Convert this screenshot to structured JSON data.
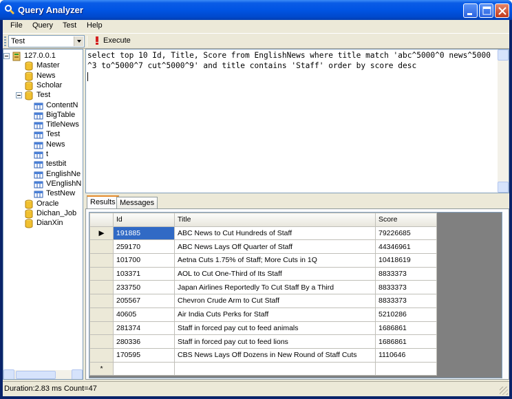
{
  "window": {
    "title": "Query Analyzer"
  },
  "menu": {
    "items": [
      "File",
      "Query",
      "Test",
      "Help"
    ]
  },
  "toolbar": {
    "database": "Test",
    "execute_label": "Execute"
  },
  "tree": {
    "nodes": [
      {
        "label": "127.0.0.1",
        "icon": "server-icon",
        "level": 0,
        "expander": true
      },
      {
        "label": "Master",
        "icon": "database-icon",
        "level": 1
      },
      {
        "label": "News",
        "icon": "database-icon",
        "level": 1
      },
      {
        "label": "Scholar",
        "icon": "database-icon",
        "level": 1
      },
      {
        "label": "Test",
        "icon": "database-icon",
        "level": 1,
        "expander": true
      },
      {
        "label": "ContentN",
        "icon": "table-icon",
        "level": 2
      },
      {
        "label": "BigTable",
        "icon": "table-icon",
        "level": 2
      },
      {
        "label": "TitleNews",
        "icon": "table-icon",
        "level": 2
      },
      {
        "label": "Test",
        "icon": "table-icon",
        "level": 2
      },
      {
        "label": "News",
        "icon": "table-icon",
        "level": 2
      },
      {
        "label": "t",
        "icon": "table-icon",
        "level": 2
      },
      {
        "label": "testbit",
        "icon": "table-icon",
        "level": 2
      },
      {
        "label": "EnglishNe",
        "icon": "table-icon",
        "level": 2
      },
      {
        "label": "VEnglishN",
        "icon": "table-icon",
        "level": 2
      },
      {
        "label": "TestNew",
        "icon": "table-icon",
        "level": 2
      },
      {
        "label": "Oracle",
        "icon": "database-icon",
        "level": 1
      },
      {
        "label": "Dichan_Job",
        "icon": "database-icon",
        "level": 1
      },
      {
        "label": "DianXin",
        "icon": "database-icon",
        "level": 1
      }
    ]
  },
  "editor": {
    "query": "select top 10 Id, Title, Score from EnglishNews where title match 'abc^5000^0 news^5000^3 to^5000^7 cut^5000^9' and title contains 'Staff' order by score desc"
  },
  "tabs": {
    "results": "Results",
    "messages": "Messages"
  },
  "grid": {
    "columns": [
      "Id",
      "Title",
      "Score"
    ],
    "rows": [
      [
        "191885",
        "ABC News to Cut Hundreds of Staff",
        "79226685"
      ],
      [
        "259170",
        "ABC News Lays Off Quarter of Staff",
        "44346961"
      ],
      [
        "101700",
        "Aetna Cuts 1.75% of Staff; More Cuts in 1Q",
        "10418619"
      ],
      [
        "103371",
        "AOL to Cut One-Third of Its Staff",
        "8833373"
      ],
      [
        "233750",
        "Japan Airlines Reportedly To Cut Staff By a Third",
        "8833373"
      ],
      [
        "205567",
        "Chevron Crude Arm to Cut Staff",
        "8833373"
      ],
      [
        "40605",
        "Air India Cuts Perks for Staff",
        "5210286"
      ],
      [
        "281374",
        "Staff in forced pay cut to feed animals",
        "1686861"
      ],
      [
        "280336",
        "Staff in forced pay cut to feed lions",
        "1686861"
      ],
      [
        "170595",
        "CBS News Lays Off Dozens in New Round of Staff Cuts",
        "1110646"
      ]
    ],
    "current_row_marker": "▶",
    "new_row_marker": "*"
  },
  "status": {
    "text": "Duration:2.83 ms Count=47"
  }
}
